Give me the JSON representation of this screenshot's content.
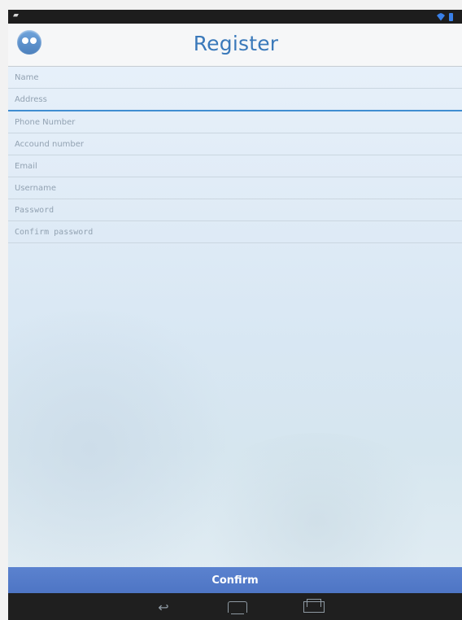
{
  "app": {
    "title": "Register",
    "icon": "app-logo-icon"
  },
  "status_bar": {
    "left_icon": "notification-icon",
    "right_icons": [
      "wifi-icon",
      "battery-icon"
    ],
    "time": ""
  },
  "form": {
    "fields": [
      {
        "name": "name",
        "placeholder": "Name",
        "value": ""
      },
      {
        "name": "address",
        "placeholder": "Address",
        "value": ""
      },
      {
        "name": "phone_number",
        "placeholder": "Phone Number",
        "value": ""
      },
      {
        "name": "account_number",
        "placeholder": "Accound number",
        "value": ""
      },
      {
        "name": "email",
        "placeholder": "Email",
        "value": ""
      },
      {
        "name": "username",
        "placeholder": "Username",
        "value": ""
      },
      {
        "name": "password",
        "placeholder": "Password",
        "value": ""
      },
      {
        "name": "confirm_password",
        "placeholder": "Confirm password",
        "value": ""
      }
    ]
  },
  "actions": {
    "confirm_label": "Confirm"
  },
  "nav_bar": {
    "icons": [
      "back-icon",
      "home-icon",
      "recent-apps-icon"
    ]
  },
  "colors": {
    "accent": "#3f8dd1",
    "title": "#3a79ba",
    "button": "#5678c8"
  }
}
